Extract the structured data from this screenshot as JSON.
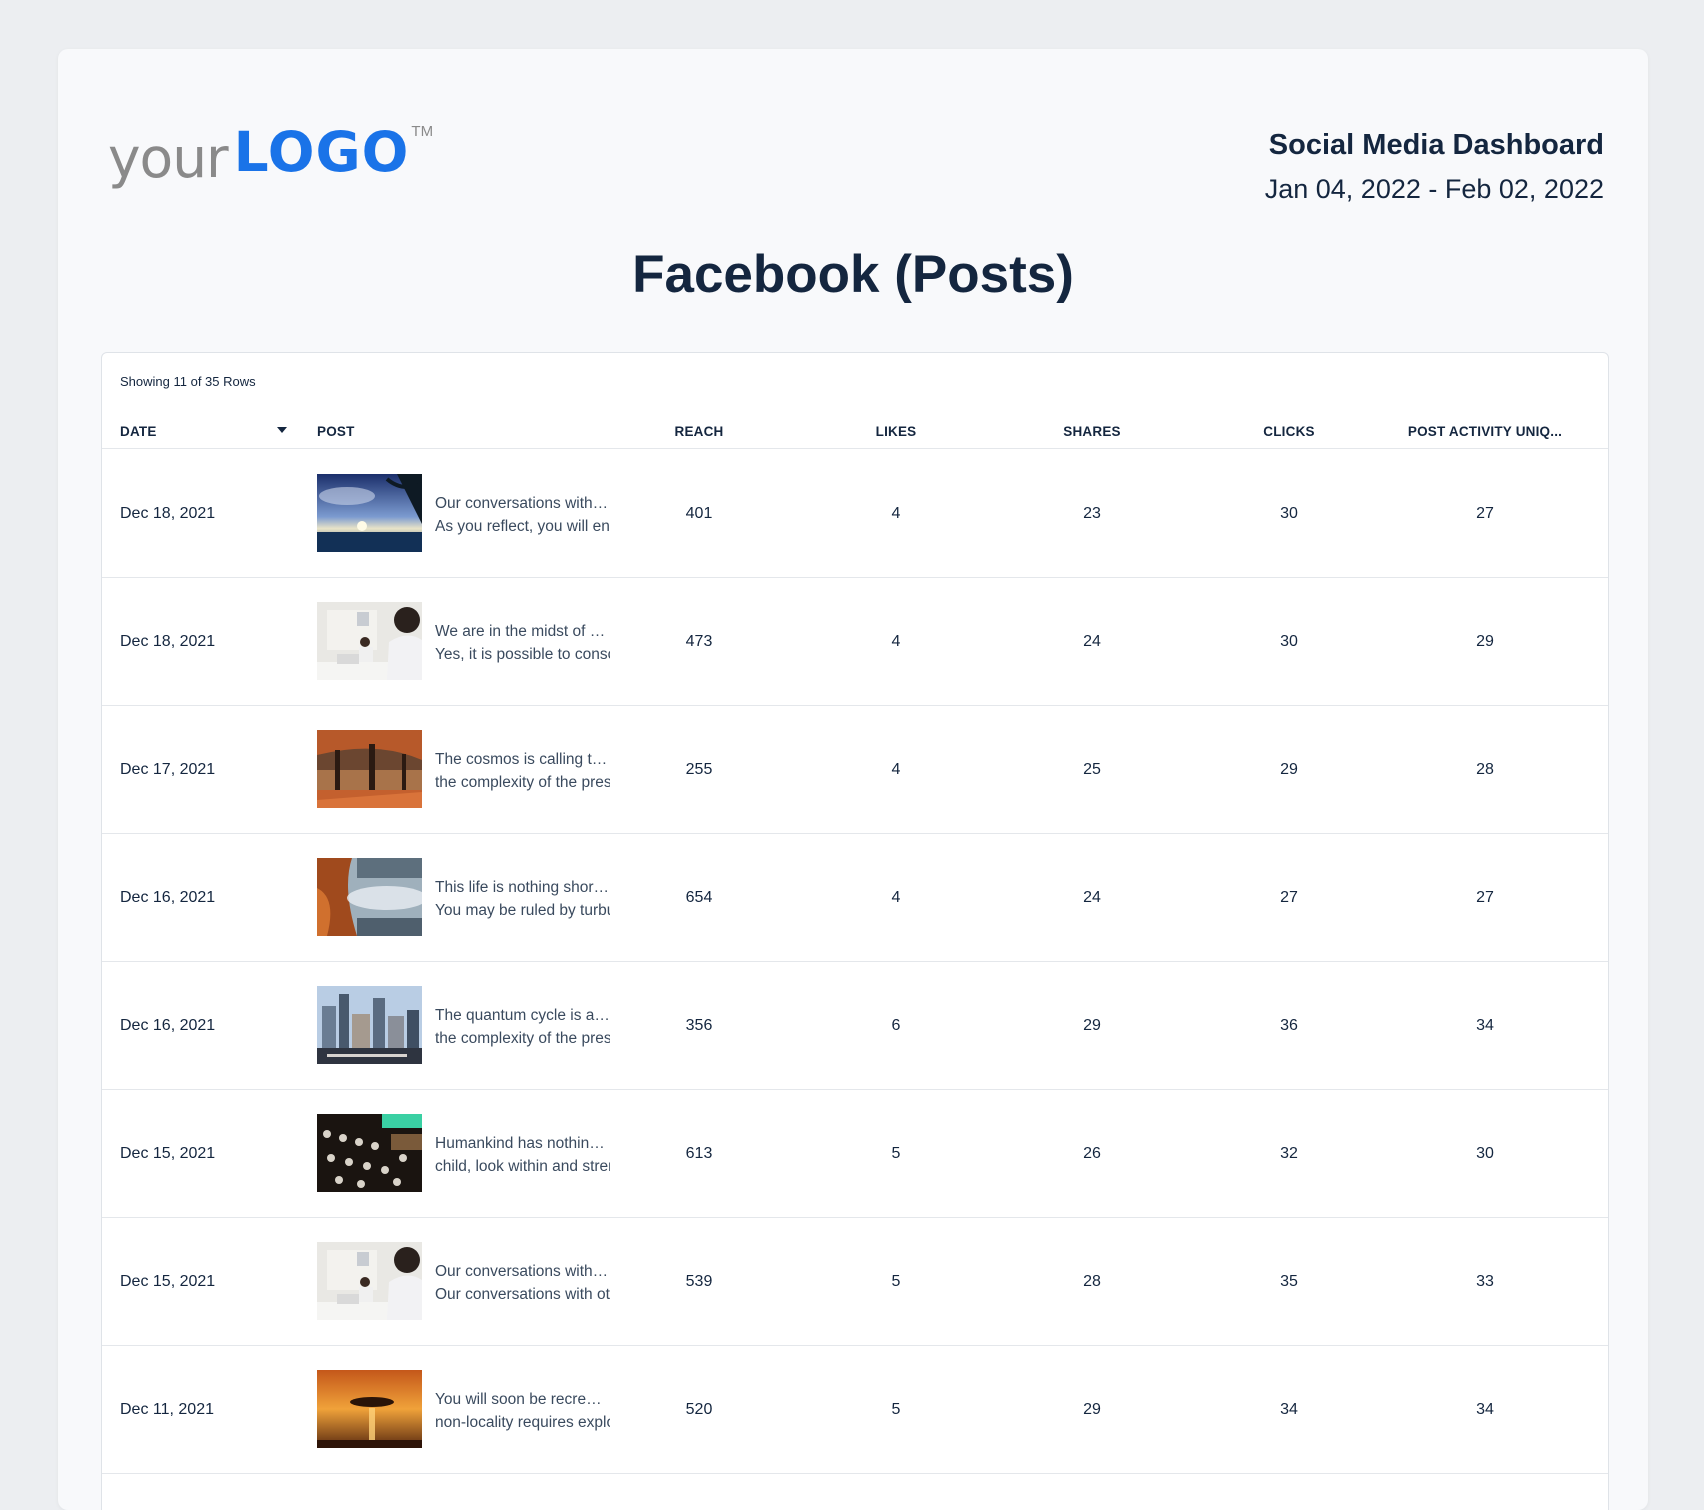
{
  "header": {
    "logo_your": "your",
    "logo_main": "LOGO",
    "logo_tm": "TM",
    "report_title": "Social Media Dashboard",
    "date_range": "Jan 04, 2022 - Feb 02, 2022"
  },
  "page_title": "Facebook (Posts)",
  "table": {
    "showing": "Showing 11 of 35 Rows",
    "columns": {
      "date": "DATE",
      "post": "POST",
      "reach": "REACH",
      "likes": "LIKES",
      "shares": "SHARES",
      "clicks": "CLICKS",
      "unique": "POST ACTIVITY UNIQ..."
    },
    "sort_icon": "caret-down-icon",
    "rows": [
      {
        "date": "Dec 18, 2021",
        "line1": "Our conversations with other beings",
        "line2": "As you reflect, you will enter",
        "reach": "401",
        "likes": "4",
        "shares": "23",
        "clicks": "30",
        "unique": "27"
      },
      {
        "date": "Dec 18, 2021",
        "line1": "We are in the midst of a self-aware",
        "line2": "Yes, it is possible to consciously",
        "reach": "473",
        "likes": "4",
        "shares": "24",
        "clicks": "30",
        "unique": "29"
      },
      {
        "date": "Dec 17, 2021",
        "line1": "The cosmos is calling to you",
        "line2": "the complexity of the present time",
        "reach": "255",
        "likes": "4",
        "shares": "25",
        "clicks": "29",
        "unique": "28"
      },
      {
        "date": "Dec 16, 2021",
        "line1": "This life is nothing short of a",
        "line2": "You may be ruled by turbulence",
        "reach": "654",
        "likes": "4",
        "shares": "24",
        "clicks": "27",
        "unique": "27"
      },
      {
        "date": "Dec 16, 2021",
        "line1": "The quantum cycle is approaching",
        "line2": "the complexity of the present time",
        "reach": "356",
        "likes": "6",
        "shares": "29",
        "clicks": "36",
        "unique": "34"
      },
      {
        "date": "Dec 15, 2021",
        "line1": "Humankind has nothing to lose",
        "line2": "child, look within and strengthen",
        "reach": "613",
        "likes": "5",
        "shares": "26",
        "clicks": "32",
        "unique": "30"
      },
      {
        "date": "Dec 15, 2021",
        "line1": "Our conversations with other beings",
        "line2": "Our conversations with other",
        "reach": "539",
        "likes": "5",
        "shares": "28",
        "clicks": "35",
        "unique": "33"
      },
      {
        "date": "Dec 11, 2021",
        "line1": "You will soon be recreated",
        "line2": "non-locality requires exploration",
        "reach": "520",
        "likes": "5",
        "shares": "29",
        "clicks": "34",
        "unique": "34"
      }
    ]
  }
}
